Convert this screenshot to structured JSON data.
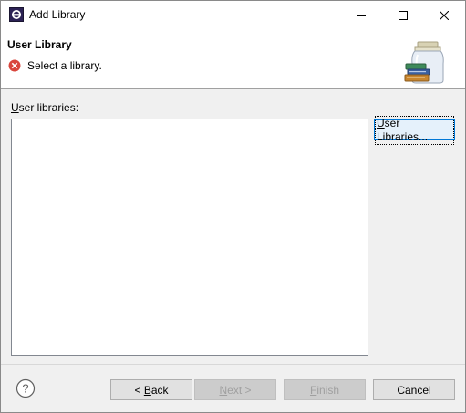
{
  "window": {
    "title": "Add Library",
    "icon": "eclipse-app-icon",
    "controls": {
      "minimize": "minimize-icon",
      "maximize": "maximize-icon",
      "close": "close-icon"
    }
  },
  "banner": {
    "title": "User Library",
    "message": "Select a library.",
    "message_icon": "error-icon",
    "image": "library-jar-books-icon"
  },
  "content": {
    "list_label_mnemonic": "U",
    "list_label_rest": "ser libraries:",
    "libraries": [],
    "user_libraries_button_mnemonic": "U",
    "user_libraries_button_rest": "ser Libraries..."
  },
  "footer": {
    "help_icon": "help-icon",
    "back_prefix": "< ",
    "back_mnemonic": "B",
    "back_rest": "ack",
    "next_mnemonic": "N",
    "next_rest": "ext >",
    "finish_mnemonic": "F",
    "finish_rest": "inish",
    "cancel_label": "Cancel"
  },
  "colors": {
    "error_red": "#d9453c",
    "focus_blue": "#0078d7",
    "disabled_text": "#a0a0a0"
  }
}
